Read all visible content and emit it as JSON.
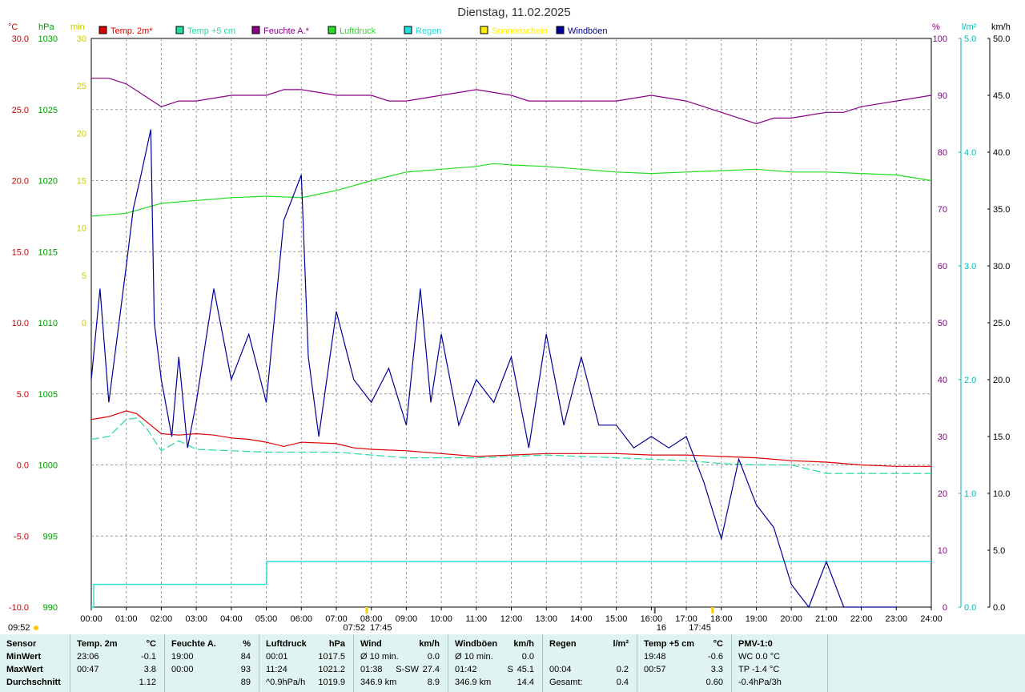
{
  "title": "Dienstag, 11.02.2025",
  "colors": {
    "temp2m": "#dd0000",
    "temp5cm": "#22dd99",
    "humidity": "#880088",
    "pressure": "#22dd22",
    "rain": "#22dddd",
    "sun": "#ffee00",
    "gust": "#000099",
    "grid": "#999999"
  },
  "legend": [
    {
      "label": "Temp. 2m*",
      "color": "#dd0000"
    },
    {
      "label": "Temp +5 cm",
      "color": "#22dd99"
    },
    {
      "label": "Feuchte A.*",
      "color": "#880088"
    },
    {
      "label": "Luftdruck",
      "color": "#22dd22"
    },
    {
      "label": "Regen",
      "color": "#22dddd"
    },
    {
      "label": "Sonnenschein",
      "color": "#ffee00"
    },
    {
      "label": "Windböen",
      "color": "#000099"
    }
  ],
  "axes": {
    "temp": {
      "unit": "°C",
      "ticks": [
        "30.0",
        "25.0",
        "20.0",
        "15.0",
        "10.0",
        "5.0",
        "0.0",
        "-5.0",
        "-10.0"
      ]
    },
    "pressure": {
      "unit": "hPa",
      "ticks": [
        "1030",
        "1025",
        "1020",
        "1015",
        "1010",
        "1005",
        "1000",
        "995",
        "990"
      ]
    },
    "sun": {
      "unit": "min",
      "ticks": [
        "30",
        "25",
        "20",
        "15",
        "10",
        "5",
        "0"
      ]
    },
    "humidity": {
      "unit": "%",
      "ticks": [
        "100",
        "90",
        "80",
        "70",
        "60",
        "50",
        "40",
        "30",
        "20",
        "10",
        "0"
      ]
    },
    "rain": {
      "unit": "l/m²",
      "ticks": [
        "5.0",
        "4.0",
        "3.0",
        "2.0",
        "1.0",
        "0.0"
      ]
    },
    "wind": {
      "unit": "km/h",
      "ticks": [
        "50.0",
        "45.0",
        "40.0",
        "35.0",
        "30.0",
        "25.0",
        "20.0",
        "15.0",
        "10.0",
        "5.0",
        "0.0"
      ]
    },
    "time": [
      "00:00",
      "01:00",
      "02:00",
      "03:00",
      "04:00",
      "05:00",
      "06:00",
      "07:00",
      "08:00",
      "09:00",
      "10:00",
      "11:00",
      "12:00",
      "13:00",
      "14:00",
      "15:00",
      "16:00",
      "17:00",
      "18:00",
      "19:00",
      "20:00",
      "21:00",
      "22:00",
      "23:00",
      "24:00"
    ]
  },
  "sun_markers": {
    "sunrise_label": "07:52",
    "sunset_label": "17:45",
    "moonrise_label": "16",
    "corner_label": "09:52"
  },
  "chart_data": {
    "type": "line",
    "title": "Dienstag, 11.02.2025",
    "x_unit": "hour of day",
    "xlim": [
      0,
      24
    ],
    "series": [
      {
        "name": "Temp. 2m*",
        "unit": "°C",
        "points": [
          [
            0,
            3.2
          ],
          [
            0.5,
            3.4
          ],
          [
            1,
            3.8
          ],
          [
            1.3,
            3.6
          ],
          [
            1.6,
            3.0
          ],
          [
            2,
            2.2
          ],
          [
            2.5,
            2.1
          ],
          [
            3,
            2.2
          ],
          [
            3.5,
            2.1
          ],
          [
            4,
            1.9
          ],
          [
            4.5,
            1.8
          ],
          [
            5,
            1.6
          ],
          [
            5.5,
            1.3
          ],
          [
            6,
            1.6
          ],
          [
            7,
            1.5
          ],
          [
            7.5,
            1.2
          ],
          [
            8,
            1.1
          ],
          [
            9,
            1.0
          ],
          [
            10,
            0.8
          ],
          [
            11,
            0.6
          ],
          [
            12,
            0.7
          ],
          [
            13,
            0.8
          ],
          [
            14,
            0.8
          ],
          [
            15,
            0.8
          ],
          [
            16,
            0.7
          ],
          [
            17,
            0.7
          ],
          [
            18,
            0.6
          ],
          [
            19,
            0.5
          ],
          [
            20,
            0.3
          ],
          [
            21,
            0.2
          ],
          [
            22,
            0.0
          ],
          [
            23,
            -0.1
          ],
          [
            24,
            -0.1
          ]
        ]
      },
      {
        "name": "Temp +5 cm",
        "unit": "°C",
        "points": [
          [
            0,
            1.8
          ],
          [
            0.5,
            2.0
          ],
          [
            1,
            3.2
          ],
          [
            1.3,
            3.3
          ],
          [
            1.6,
            2.5
          ],
          [
            2,
            1.0
          ],
          [
            2.5,
            1.7
          ],
          [
            3,
            1.1
          ],
          [
            4,
            1.0
          ],
          [
            5,
            0.9
          ],
          [
            6,
            0.9
          ],
          [
            7,
            0.9
          ],
          [
            8,
            0.7
          ],
          [
            9,
            0.5
          ],
          [
            10,
            0.5
          ],
          [
            11,
            0.5
          ],
          [
            12,
            0.6
          ],
          [
            13,
            0.7
          ],
          [
            14,
            0.6
          ],
          [
            15,
            0.5
          ],
          [
            16,
            0.4
          ],
          [
            17,
            0.3
          ],
          [
            18,
            0.1
          ],
          [
            19,
            0.0
          ],
          [
            20,
            0.0
          ],
          [
            21,
            -0.6
          ],
          [
            22,
            -0.6
          ],
          [
            23,
            -0.6
          ],
          [
            24,
            -0.6
          ]
        ]
      },
      {
        "name": "Feuchte A.*",
        "unit": "%",
        "points": [
          [
            0,
            93
          ],
          [
            0.5,
            93
          ],
          [
            1,
            92
          ],
          [
            1.5,
            90
          ],
          [
            2,
            88
          ],
          [
            2.5,
            89
          ],
          [
            3,
            89
          ],
          [
            4,
            90
          ],
          [
            5,
            90
          ],
          [
            5.5,
            91
          ],
          [
            6,
            91
          ],
          [
            7,
            90
          ],
          [
            8,
            90
          ],
          [
            8.5,
            89
          ],
          [
            9,
            89
          ],
          [
            10,
            90
          ],
          [
            11,
            91
          ],
          [
            12,
            90
          ],
          [
            12.5,
            89
          ],
          [
            13,
            89
          ],
          [
            14,
            89
          ],
          [
            15,
            89
          ],
          [
            16,
            90
          ],
          [
            17,
            89
          ],
          [
            18,
            87
          ],
          [
            19,
            85
          ],
          [
            19.5,
            86
          ],
          [
            20,
            86
          ],
          [
            21,
            87
          ],
          [
            21.5,
            87
          ],
          [
            22,
            88
          ],
          [
            23,
            89
          ],
          [
            24,
            90
          ]
        ]
      },
      {
        "name": "Luftdruck",
        "unit": "hPa",
        "points": [
          [
            0,
            1017.5
          ],
          [
            1,
            1017.7
          ],
          [
            2,
            1018.4
          ],
          [
            3,
            1018.6
          ],
          [
            4,
            1018.8
          ],
          [
            5,
            1018.9
          ],
          [
            6,
            1018.8
          ],
          [
            7,
            1019.3
          ],
          [
            8,
            1020.0
          ],
          [
            9,
            1020.6
          ],
          [
            10,
            1020.8
          ],
          [
            11,
            1021.0
          ],
          [
            11.5,
            1021.2
          ],
          [
            12,
            1021.1
          ],
          [
            13,
            1021.0
          ],
          [
            14,
            1020.8
          ],
          [
            15,
            1020.6
          ],
          [
            16,
            1020.5
          ],
          [
            17,
            1020.6
          ],
          [
            18,
            1020.7
          ],
          [
            19,
            1020.8
          ],
          [
            20,
            1020.6
          ],
          [
            21,
            1020.6
          ],
          [
            22,
            1020.5
          ],
          [
            23,
            1020.4
          ],
          [
            24,
            1020.0
          ]
        ]
      },
      {
        "name": "Regen",
        "unit": "l/m²",
        "points": [
          [
            0,
            0.0
          ],
          [
            0.07,
            0.2
          ],
          [
            5,
            0.2
          ],
          [
            5.01,
            0.4
          ],
          [
            24,
            0.4
          ]
        ]
      },
      {
        "name": "Windböen",
        "unit": "km/h",
        "points": [
          [
            0,
            20
          ],
          [
            0.25,
            28
          ],
          [
            0.5,
            18
          ],
          [
            0.75,
            24
          ],
          [
            1,
            30
          ],
          [
            1.2,
            35
          ],
          [
            1.42,
            38
          ],
          [
            1.7,
            42
          ],
          [
            1.8,
            25
          ],
          [
            2,
            20
          ],
          [
            2.3,
            15
          ],
          [
            2.5,
            22
          ],
          [
            2.75,
            14
          ],
          [
            3,
            18
          ],
          [
            3.5,
            28
          ],
          [
            4,
            20
          ],
          [
            4.5,
            24
          ],
          [
            5,
            18
          ],
          [
            5.5,
            34
          ],
          [
            6,
            38
          ],
          [
            6.2,
            22
          ],
          [
            6.5,
            15
          ],
          [
            7,
            26
          ],
          [
            7.5,
            20
          ],
          [
            8,
            18
          ],
          [
            8.5,
            21
          ],
          [
            9,
            16
          ],
          [
            9.4,
            28
          ],
          [
            9.7,
            18
          ],
          [
            10,
            24
          ],
          [
            10.5,
            16
          ],
          [
            11,
            20
          ],
          [
            11.5,
            18
          ],
          [
            12,
            22
          ],
          [
            12.5,
            14
          ],
          [
            13,
            24
          ],
          [
            13.5,
            16
          ],
          [
            14,
            22
          ],
          [
            14.5,
            16
          ],
          [
            15,
            16
          ],
          [
            15.5,
            14
          ],
          [
            16,
            15
          ],
          [
            16.5,
            14
          ],
          [
            17,
            15
          ],
          [
            17.5,
            11
          ],
          [
            18,
            6
          ],
          [
            18.5,
            13
          ],
          [
            19,
            9
          ],
          [
            19.5,
            7
          ],
          [
            20,
            2
          ],
          [
            20.5,
            0
          ],
          [
            21,
            4
          ],
          [
            21.5,
            0
          ],
          [
            22,
            0
          ],
          [
            23,
            0
          ]
        ]
      }
    ]
  },
  "stats": {
    "columns": [
      {
        "header": "Sensor",
        "unit": "",
        "rows": [
          [
            "MinWert",
            "",
            ""
          ],
          [
            "MaxWert",
            "",
            ""
          ],
          [
            "Durchschnitt",
            "",
            ""
          ]
        ]
      },
      {
        "header": "Temp. 2m",
        "unit": "°C",
        "rows": [
          [
            "23:06",
            "",
            "-0.1"
          ],
          [
            "00:47",
            "",
            "3.8"
          ],
          [
            "",
            "",
            "1.12"
          ]
        ]
      },
      {
        "header": "Feuchte A.",
        "unit": "%",
        "rows": [
          [
            "19:00",
            "",
            "84"
          ],
          [
            "00:00",
            "",
            "93"
          ],
          [
            "",
            "",
            "89"
          ]
        ]
      },
      {
        "header": "Luftdruck",
        "unit": "hPa",
        "rows": [
          [
            "00:01",
            "",
            "1017.5"
          ],
          [
            "11:24",
            "",
            "1021.2"
          ],
          [
            "^0.9hPa/h",
            "",
            "1019.9"
          ]
        ]
      },
      {
        "header": "Wind",
        "unit": "km/h",
        "rows": [
          [
            "Ø 10 min.",
            "",
            "0.0"
          ],
          [
            "01:38",
            "S-SW",
            "27.4"
          ],
          [
            "346.9 km",
            "",
            "8.9"
          ]
        ]
      },
      {
        "header": "Windböen",
        "unit": "km/h",
        "rows": [
          [
            "Ø 10 min.",
            "",
            "0.0"
          ],
          [
            "01:42",
            "S",
            "45.1"
          ],
          [
            "346.9 km",
            "",
            "14.4"
          ]
        ]
      },
      {
        "header": "Regen",
        "unit": "l/m²",
        "rows": [
          [
            "",
            "",
            ""
          ],
          [
            "00:04",
            "",
            "0.2"
          ],
          [
            "Gesamt:",
            "",
            "0.4"
          ]
        ]
      },
      {
        "header": "Temp +5 cm",
        "unit": "°C",
        "rows": [
          [
            "19:48",
            "",
            "-0.6"
          ],
          [
            "00:57",
            "",
            "3.3"
          ],
          [
            "",
            "",
            "0.60"
          ]
        ]
      },
      {
        "header": "PMV-1:0",
        "unit": "",
        "rows": [
          [
            "WC 0.0 °C",
            "",
            ""
          ],
          [
            "TP -1.4 °C",
            "",
            ""
          ],
          [
            "-0.4hPa/3h",
            "",
            ""
          ]
        ]
      }
    ]
  }
}
